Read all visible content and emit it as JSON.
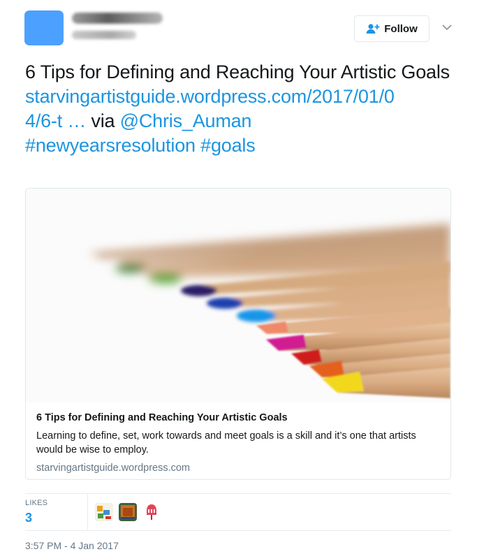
{
  "header": {
    "follow_label": "Follow",
    "icons": [
      "follow-person-icon",
      "chevron-down-icon"
    ]
  },
  "tweet": {
    "text_line1": "6 Tips for Defining and Reaching Your Artistic Goals",
    "link_part1": "starvingartistguide.wordpress.com/2017/01/0",
    "link_part2": "4/6-t",
    "ellipsis": " …",
    "via_word": " via ",
    "mention": "@Chris_Auman",
    "hashtag1": "#newyearsresolution",
    "hashtag2": "#goals"
  },
  "card": {
    "title": "6 Tips for Defining and Reaching Your Artistic Goals",
    "description": "Learning to define, set, work towards and meet goals is a skill and it’s one that artists would be wise to employ.",
    "domain": "starvingartistguide.wordpress.com"
  },
  "stats": {
    "likes_label": "LIKES",
    "likes_count": "3"
  },
  "timestamp": "3:57 PM - 4 Jan 2017",
  "colors": {
    "link": "#1b95e0",
    "avatar": "#4ca0ff",
    "text": "#14171a",
    "muted": "#657786"
  }
}
